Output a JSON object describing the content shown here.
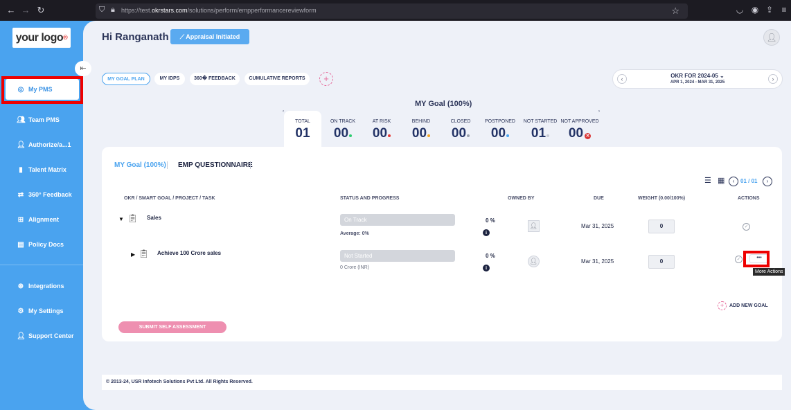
{
  "browser": {
    "url_prefix": "https://test.",
    "url_domain": "okrstars.com",
    "url_path": "/solutions/perform/empperformancereviewform"
  },
  "logo": {
    "text": "your logo",
    "mark": "®"
  },
  "sidebar": {
    "items": [
      {
        "label": "My PMS",
        "icon": "target-icon"
      },
      {
        "label": "Team PMS",
        "icon": "team-icon"
      },
      {
        "label": "Authorize/a...1",
        "icon": "user-icon"
      },
      {
        "label": "Talent Matrix",
        "icon": "matrix-icon"
      },
      {
        "label": "360° Feedback",
        "icon": "feedback-icon"
      },
      {
        "label": "Alignment",
        "icon": "alignment-icon"
      },
      {
        "label": "Policy Docs",
        "icon": "document-icon"
      },
      {
        "label": "Integrations",
        "icon": "integrations-icon"
      },
      {
        "label": "My Settings",
        "icon": "gear-icon"
      },
      {
        "label": "Support Center",
        "icon": "support-icon"
      }
    ]
  },
  "header": {
    "greeting": "Hi Ranganath",
    "status_button": "Appraisal Initiated"
  },
  "nav_tabs": [
    "MY GOAL PLAN",
    "MY IDPS",
    "360� FEEDBACK",
    "CUMULATIVE REPORTS"
  ],
  "period": {
    "title": "OKR FOR 2024-05",
    "range": "APR 1, 2024 - MAR 31, 2025"
  },
  "summary": {
    "title": "MY Goal (100%)",
    "stats": [
      {
        "label": "TOTAL",
        "value": "01"
      },
      {
        "label": "ON TRACK",
        "value": "00",
        "color": "#2ecc71"
      },
      {
        "label": "AT RISK",
        "value": "00",
        "color": "#e53935"
      },
      {
        "label": "BEHIND",
        "value": "00",
        "color": "#f5a623"
      },
      {
        "label": "CLOSED",
        "value": "00",
        "color": "#9aa0ac"
      },
      {
        "label": "POSTPONED",
        "value": "00",
        "color": "#4aa3ef"
      },
      {
        "label": "NOT STARTED",
        "value": "01",
        "color": "#c6cad4"
      },
      {
        "label": "NOT APPROVED",
        "value": "00",
        "color": "#d93636"
      }
    ]
  },
  "goal_tabs": [
    "MY Goal (100%)",
    "EMP QUESTIONNAIRE"
  ],
  "pagination": {
    "text": "01 / 01"
  },
  "table": {
    "headers": [
      "OKR / SMART GOAL / PROJECT / TASK",
      "STATUS AND PROGRESS",
      "OWNED BY",
      "DUE",
      "WEIGHT (0.00/100%)",
      "ACTIONS"
    ],
    "rows": [
      {
        "title": "Sales",
        "status": "On Track",
        "note": "Average: 0%",
        "progress": "0 %",
        "due": "Mar 31, 2025",
        "weight": "0"
      },
      {
        "title": "Achieve 100 Crore sales",
        "status": "Not Started",
        "note": "0 Crore (INR)",
        "progress": "0 %",
        "due": "Mar 31, 2025",
        "weight": "0"
      }
    ]
  },
  "actions": {
    "more_label": "•••",
    "tooltip": "More Actions",
    "add_goal": "ADD NEW GOAL",
    "submit": "SUBMIT SELF ASSESSMENT"
  },
  "footer": "© 2013-24, USR Infotech Solutions Pvt Ltd. All Rights Reserved."
}
